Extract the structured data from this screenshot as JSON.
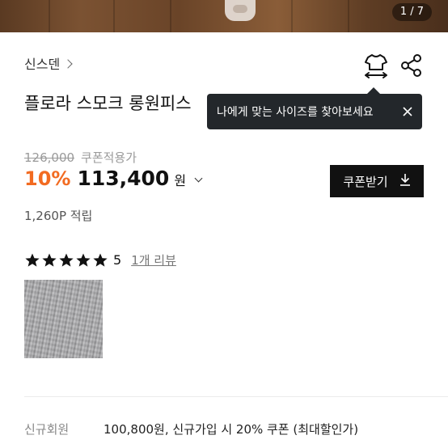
{
  "gallery": {
    "counter": "1 / 7"
  },
  "product": {
    "brand": "신스덴",
    "title": "플로라 스모크 롱원피스"
  },
  "tooltip": {
    "text": "나에게 맞는 사이즈를 찾아보세요"
  },
  "price": {
    "original": "126,000",
    "coupon_applied_label": "쿠폰적용가",
    "discount": "10%",
    "sale": "113,400",
    "currency": "원"
  },
  "coupon_button": {
    "label": "쿠폰받기"
  },
  "points": {
    "text": "1,260P 적립"
  },
  "review": {
    "stars": 5,
    "rating": "5",
    "link": "1개 리뷰"
  },
  "new_member": {
    "label": "신규회원",
    "text": "100,800원, 신규가입 시 20% 쿠폰 (최대할인가)"
  },
  "colors": {
    "accent": "#f26b21",
    "tooltip_bg": "#23272b",
    "button_bg": "#111111"
  },
  "icons": [
    "size-guide-icon",
    "share-icon",
    "close-icon",
    "download-icon",
    "star-icon",
    "chevron-right-icon",
    "chevron-down-icon"
  ]
}
